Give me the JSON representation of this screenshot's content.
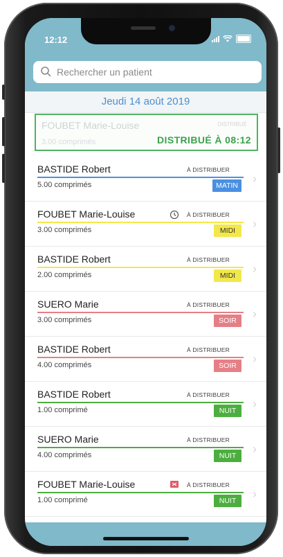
{
  "status_bar": {
    "time": "12:12"
  },
  "search": {
    "placeholder": "Rechercher un patient"
  },
  "date": "Jeudi 14 août 2019",
  "distributed_card": {
    "name": "FOUBET Marie-Louise",
    "status": "DISTRIBUÉ",
    "quantity": "3.00 comprimés",
    "banner": "DISTRIBUÉ À 08:12"
  },
  "rows": [
    {
      "name": "BASTIDE Robert",
      "status": "À DISTRIBUER",
      "quantity": "5.00 comprimés",
      "period": "MATIN",
      "accent": "#4a90e2",
      "badge_text": "#ffffff",
      "icon": ""
    },
    {
      "name": "FOUBET Marie-Louise",
      "status": "À DISTRIBUER",
      "quantity": "3.00 comprimés",
      "period": "MIDI",
      "accent": "#f3e84b",
      "badge_text": "#333333",
      "icon": "clock-icon"
    },
    {
      "name": "BASTIDE Robert",
      "status": "À DISTRIBUER",
      "quantity": "2.00 comprimés",
      "period": "MIDI",
      "accent": "#f3e84b",
      "badge_text": "#333333",
      "icon": ""
    },
    {
      "name": "SUERO Marie",
      "status": "À DISTRIBUER",
      "quantity": "3.00 comprimés",
      "period": "SOIR",
      "accent": "#e57f86",
      "badge_text": "#ffffff",
      "icon": ""
    },
    {
      "name": "BASTIDE Robert",
      "status": "À DISTRIBUER",
      "quantity": "4.00 comprimés",
      "period": "SOIR",
      "accent": "#e57f86",
      "badge_text": "#ffffff",
      "icon": ""
    },
    {
      "name": "BASTIDE Robert",
      "status": "À DISTRIBUER",
      "quantity": "1.00 comprimé",
      "period": "NUIT",
      "accent": "#4cae3f",
      "badge_text": "#ffffff",
      "icon": ""
    },
    {
      "name": "SUERO Marie",
      "status": "À DISTRIBUER",
      "quantity": "4.00 comprimés",
      "period": "NUIT",
      "accent": "#4cae3f",
      "badge_text": "#ffffff",
      "icon": ""
    },
    {
      "name": "FOUBET Marie-Louise",
      "status": "À DISTRIBUER",
      "quantity": "1.00 comprimé",
      "period": "NUIT",
      "accent": "#4cae3f",
      "badge_text": "#ffffff",
      "icon": "flag-icon"
    }
  ],
  "colors": {
    "bar": "#7fb9ca",
    "date_text": "#4a8fd0",
    "done_border": "#4cb45f"
  }
}
